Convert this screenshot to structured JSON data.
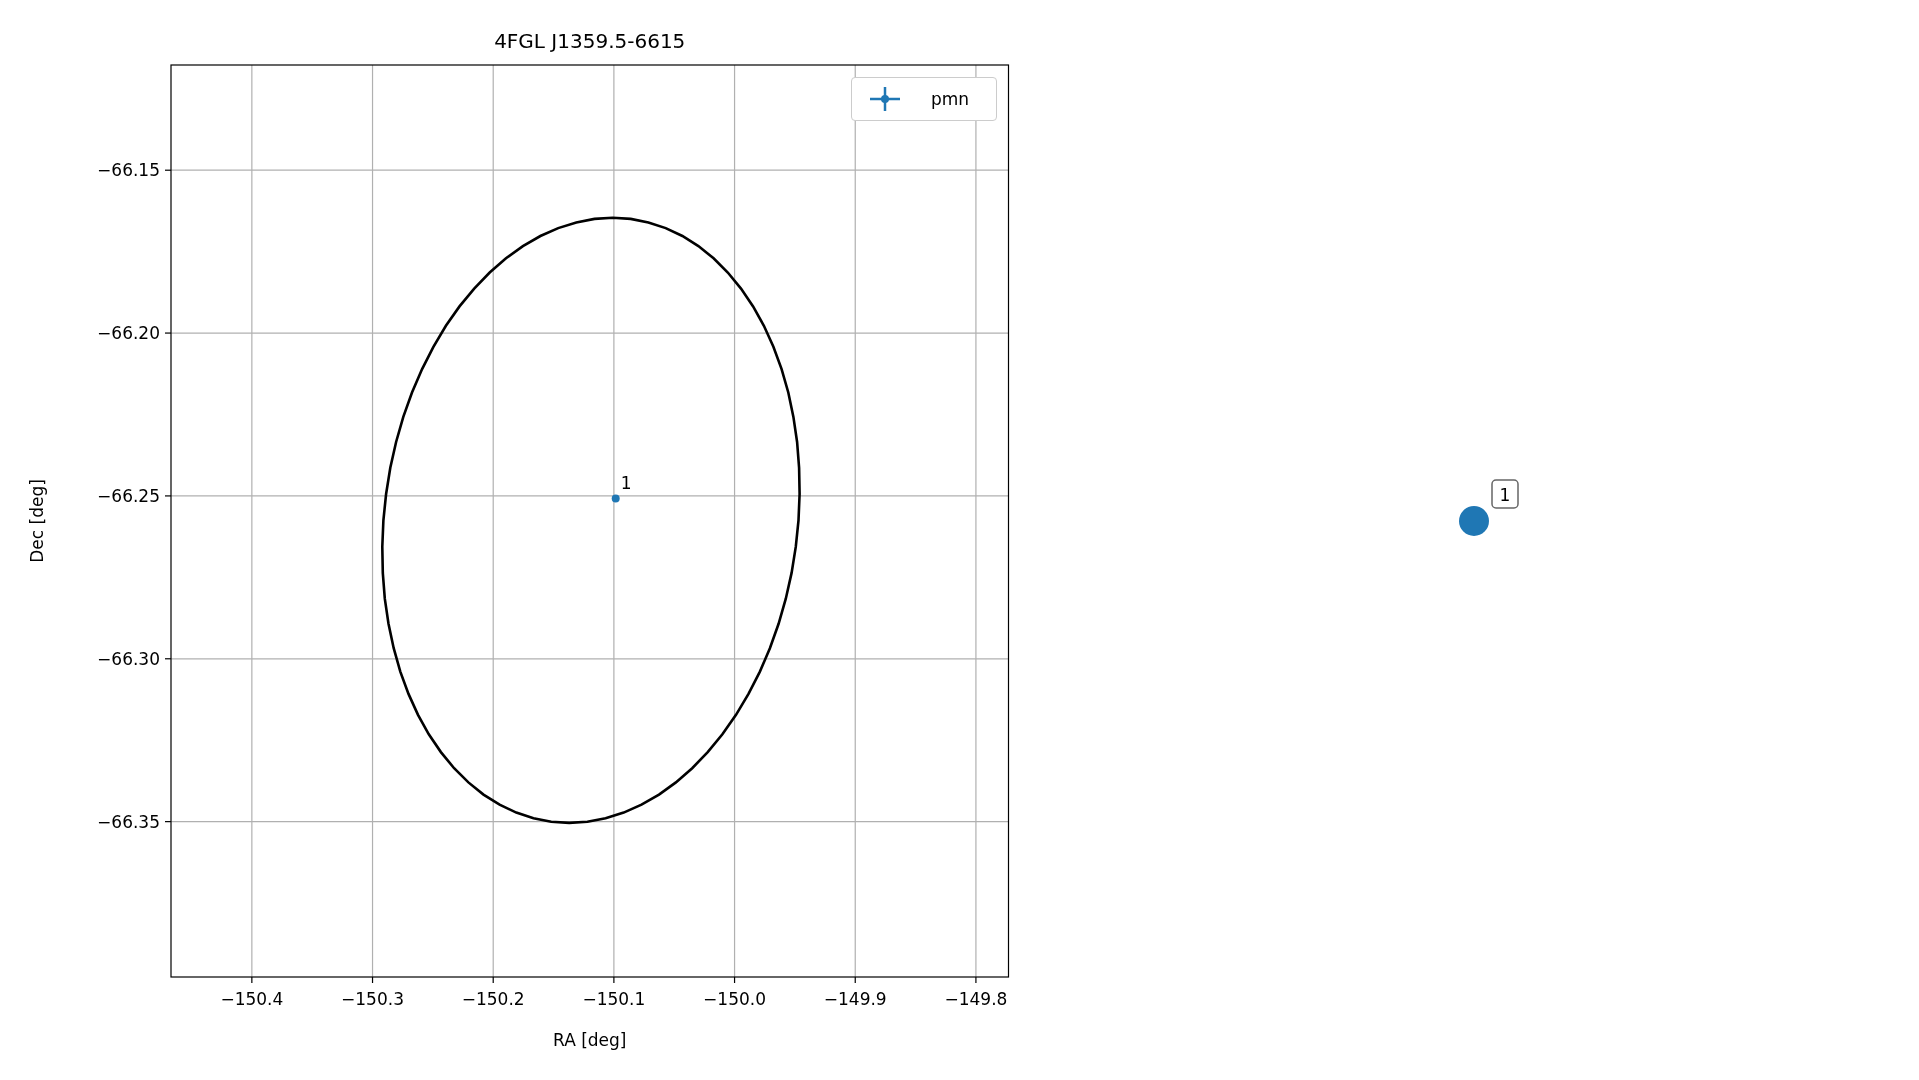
{
  "chart_data": {
    "type": "scatter",
    "grid": true,
    "title": "4FGL J1359.5-6615",
    "xlabel": "RA [deg]",
    "ylabel": "Dec [deg]",
    "xlim": [
      -150.467,
      -149.773
    ],
    "ylim": [
      -66.3977,
      -66.1177
    ],
    "xticks": [
      {
        "value": -150.4,
        "label": "−150.4"
      },
      {
        "value": -150.3,
        "label": "−150.3"
      },
      {
        "value": -150.2,
        "label": "−150.2"
      },
      {
        "value": -150.1,
        "label": "−150.1"
      },
      {
        "value": -150.0,
        "label": "−150.0"
      },
      {
        "value": -149.9,
        "label": "−149.9"
      },
      {
        "value": -149.8,
        "label": "−149.8"
      }
    ],
    "yticks": [
      {
        "value": -66.15,
        "label": "−66.15"
      },
      {
        "value": -66.2,
        "label": "−66.20"
      },
      {
        "value": -66.25,
        "label": "−66.25"
      },
      {
        "value": -66.3,
        "label": "−66.30"
      },
      {
        "value": -66.35,
        "label": "−66.35"
      }
    ],
    "series": [
      {
        "name": "pmn",
        "color": "#1f77b4",
        "x": [
          -150.0985
        ],
        "values": [
          -66.2508
        ]
      }
    ],
    "annotations": [
      {
        "x": -150.0985,
        "y": -66.2508,
        "text": "1"
      }
    ]
  },
  "marker_panel": {
    "label": "1",
    "color": "#1f77b4"
  }
}
